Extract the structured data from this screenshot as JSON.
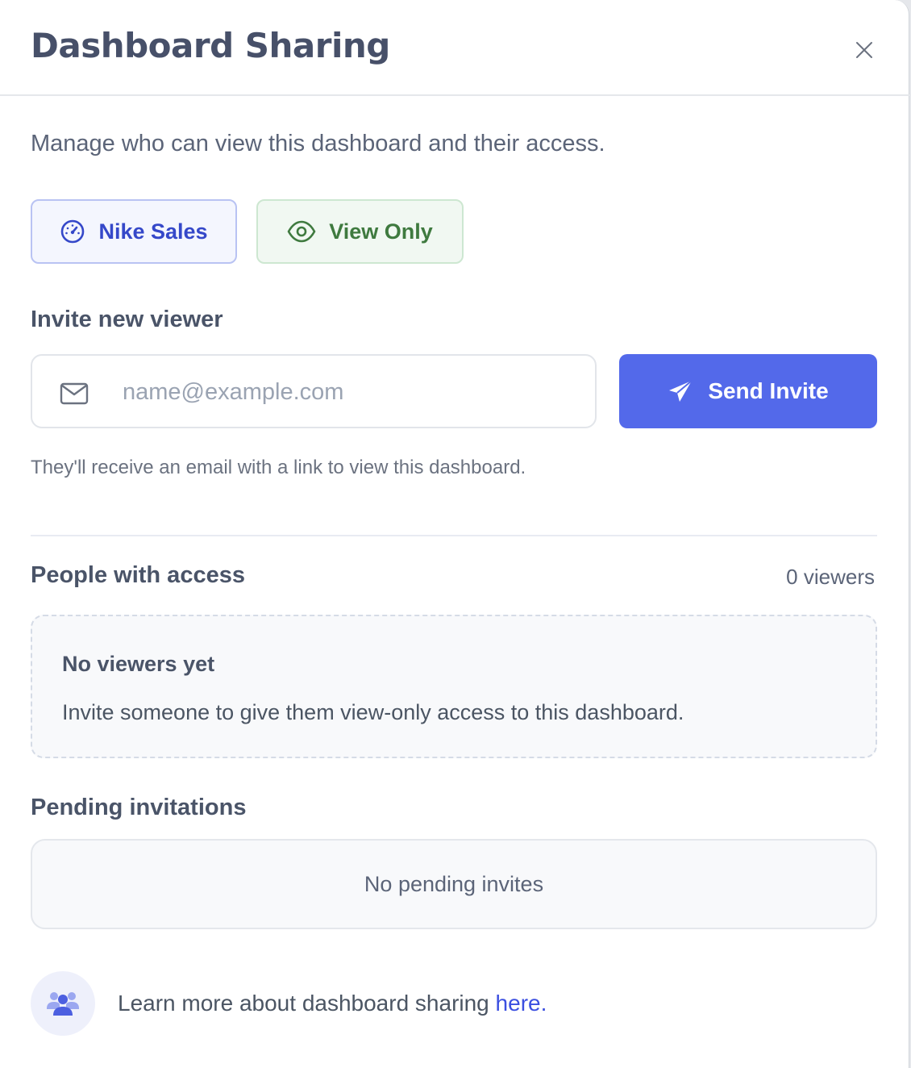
{
  "header": {
    "title": "Dashboard Sharing",
    "close_icon": "close-icon"
  },
  "intro": {
    "subtitle": "Manage who can view this dashboard and their access."
  },
  "chips": {
    "dashboard": {
      "label": "Nike Sales",
      "icon": "gauge-icon",
      "color": "#3548c9"
    },
    "access": {
      "label": "View Only",
      "icon": "eye-icon",
      "color": "#3f7a3f"
    }
  },
  "invite": {
    "heading": "Invite new viewer",
    "email_placeholder": "name@example.com",
    "email_value": "",
    "mail_icon": "mail-icon",
    "send_label": "Send Invite",
    "send_icon": "paper-plane-icon",
    "send_color": "#5369ea",
    "hint": "They'll receive an email with a link to view this dashboard."
  },
  "people": {
    "heading": "People with access",
    "count": "0 viewers",
    "empty_title": "No viewers yet",
    "empty_text": "Invite someone to give them view-only access to this dashboard."
  },
  "pending": {
    "heading": "Pending invitations",
    "empty_text": "No pending invites"
  },
  "footer": {
    "icon": "users-icon",
    "text": "Learn more about dashboard sharing ",
    "link_text": "here."
  }
}
